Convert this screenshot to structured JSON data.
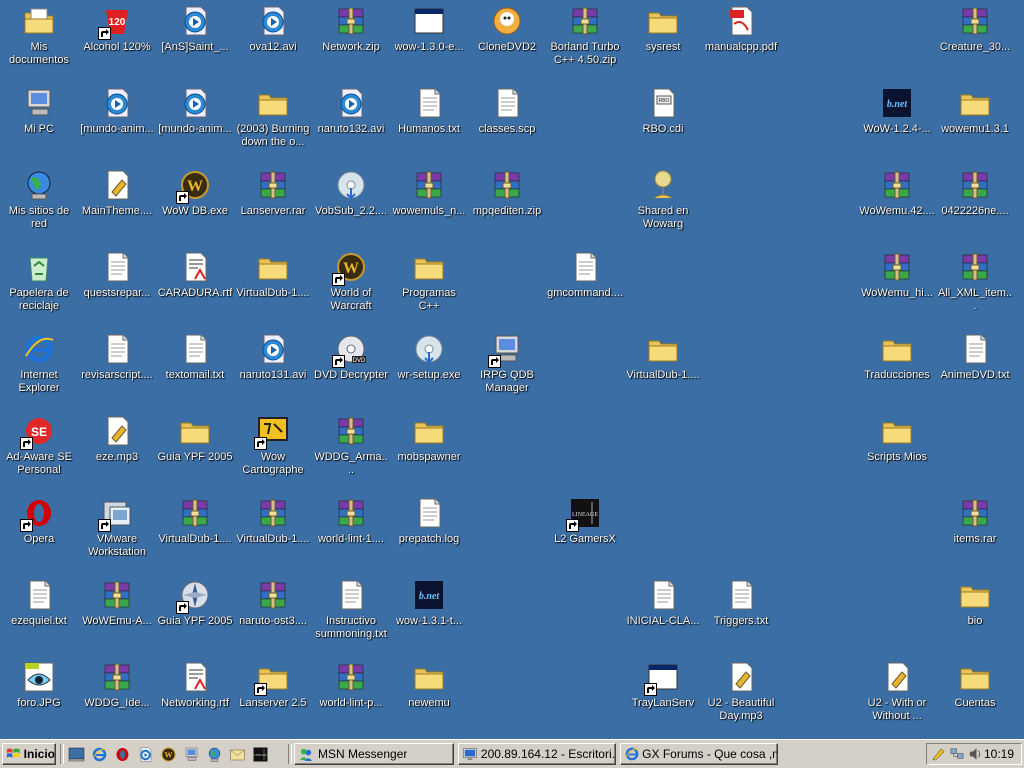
{
  "desktop": {
    "icons": [
      {
        "name": "my-documents-icon",
        "label": "Mis documentos",
        "kind": "mydocs",
        "sc": false,
        "col": 0,
        "row": 0
      },
      {
        "name": "alcohol-icon",
        "label": "Alcohol 120%",
        "kind": "alcohol",
        "sc": true,
        "col": 1,
        "row": 0
      },
      {
        "name": "avi-file-icon",
        "label": "[AnS]Saint_...",
        "kind": "media",
        "sc": false,
        "col": 2,
        "row": 0
      },
      {
        "name": "avi-file-icon",
        "label": "ova12.avi",
        "kind": "media",
        "sc": false,
        "col": 3,
        "row": 0
      },
      {
        "name": "zip-file-icon",
        "label": "Network.zip",
        "kind": "rar",
        "sc": false,
        "col": 4,
        "row": 0
      },
      {
        "name": "exe-file-icon",
        "label": "wow-1.3.0-e...",
        "kind": "window",
        "sc": false,
        "col": 5,
        "row": 0
      },
      {
        "name": "clonedvd-icon",
        "label": "CloneDVD2",
        "kind": "clonedvd",
        "sc": false,
        "col": 6,
        "row": 0
      },
      {
        "name": "zip-file-icon",
        "label": "Borland Turbo C++ 4.50.zip",
        "kind": "rar",
        "sc": false,
        "col": 7,
        "row": 0
      },
      {
        "name": "folder-icon",
        "label": "sysrest",
        "kind": "folder",
        "sc": false,
        "col": 8,
        "row": 0
      },
      {
        "name": "pdf-file-icon",
        "label": "manualcpp.pdf",
        "kind": "pdf",
        "sc": false,
        "col": 9,
        "row": 0
      },
      {
        "name": "rar-file-icon",
        "label": "Creature_30...",
        "kind": "rar",
        "sc": false,
        "col": 12,
        "row": 0
      },
      {
        "name": "my-computer-icon",
        "label": "Mi PC",
        "kind": "mypc",
        "sc": false,
        "col": 0,
        "row": 1
      },
      {
        "name": "avi-file-icon",
        "label": "[mundo-anim...",
        "kind": "media",
        "sc": false,
        "col": 1,
        "row": 1
      },
      {
        "name": "avi-file-icon",
        "label": "[mundo-anim...",
        "kind": "media",
        "sc": false,
        "col": 2,
        "row": 1
      },
      {
        "name": "folder-icon",
        "label": "(2003) Burning down the o...",
        "kind": "folder",
        "sc": false,
        "col": 3,
        "row": 1
      },
      {
        "name": "avi-file-icon",
        "label": "naruto132.avi",
        "kind": "media",
        "sc": false,
        "col": 4,
        "row": 1
      },
      {
        "name": "txt-file-icon",
        "label": "Humanos.txt",
        "kind": "txt",
        "sc": false,
        "col": 5,
        "row": 1
      },
      {
        "name": "txt-file-icon",
        "label": "classes.scp",
        "kind": "txt",
        "sc": false,
        "col": 6,
        "row": 1
      },
      {
        "name": "cdi-file-icon",
        "label": "RBO.cdi",
        "kind": "cdi",
        "sc": false,
        "col": 8,
        "row": 1
      },
      {
        "name": "bnet-icon",
        "label": "WoW-1.2.4-...",
        "kind": "bnet",
        "sc": false,
        "col": 11,
        "row": 1
      },
      {
        "name": "folder-icon",
        "label": "wowemu1.3.1",
        "kind": "folder",
        "sc": false,
        "col": 12,
        "row": 1
      },
      {
        "name": "network-places-icon",
        "label": "Mis sitios de red",
        "kind": "globe",
        "sc": false,
        "col": 0,
        "row": 2
      },
      {
        "name": "theme-file-icon",
        "label": "MainTheme....",
        "kind": "mp3",
        "sc": false,
        "col": 1,
        "row": 2
      },
      {
        "name": "wow-db-icon",
        "label": "WoW DB.exe",
        "kind": "wow",
        "sc": true,
        "col": 2,
        "row": 2
      },
      {
        "name": "rar-file-icon",
        "label": "Lanserver.rar",
        "kind": "rar",
        "sc": false,
        "col": 3,
        "row": 2
      },
      {
        "name": "vobsub-icon",
        "label": "VobSub_2.2....",
        "kind": "cd",
        "sc": false,
        "col": 4,
        "row": 2
      },
      {
        "name": "rar-file-icon",
        "label": "wowemuls_n...",
        "kind": "rar",
        "sc": false,
        "col": 5,
        "row": 2
      },
      {
        "name": "zip-file-icon",
        "label": "mpqediten.zip",
        "kind": "rar",
        "sc": false,
        "col": 6,
        "row": 2
      },
      {
        "name": "shared-folder-icon",
        "label": "Shared en Wowarg",
        "kind": "shared",
        "sc": false,
        "col": 8,
        "row": 2
      },
      {
        "name": "rar-file-icon",
        "label": "WoWemu.42....",
        "kind": "rar",
        "sc": false,
        "col": 11,
        "row": 2
      },
      {
        "name": "rar-file-icon",
        "label": "0422226ne....",
        "kind": "rar",
        "sc": false,
        "col": 12,
        "row": 2
      },
      {
        "name": "recycle-bin-icon",
        "label": "Papelera de reciclaje",
        "kind": "recycle",
        "sc": false,
        "col": 0,
        "row": 3
      },
      {
        "name": "txt-file-icon",
        "label": "questsrepar...",
        "kind": "txt",
        "sc": false,
        "col": 1,
        "row": 3
      },
      {
        "name": "rtf-file-icon",
        "label": "CARADURA.rtf",
        "kind": "rtf",
        "sc": false,
        "col": 2,
        "row": 3
      },
      {
        "name": "folder-icon",
        "label": "VirtualDub-1....",
        "kind": "folder",
        "sc": false,
        "col": 3,
        "row": 3
      },
      {
        "name": "wow-icon",
        "label": "World of Warcraft",
        "kind": "wow",
        "sc": true,
        "col": 4,
        "row": 3
      },
      {
        "name": "folder-icon",
        "label": "Programas C++",
        "kind": "folder",
        "sc": false,
        "col": 5,
        "row": 3
      },
      {
        "name": "txt-file-icon",
        "label": "gmcommand....",
        "kind": "txt",
        "sc": false,
        "col": 7,
        "row": 3
      },
      {
        "name": "rar-file-icon",
        "label": "WoWemu_hi...",
        "kind": "rar",
        "sc": false,
        "col": 11,
        "row": 3
      },
      {
        "name": "rar-file-icon",
        "label": "All_XML_item...",
        "kind": "rar",
        "sc": false,
        "col": 12,
        "row": 3
      },
      {
        "name": "internet-explorer-icon",
        "label": "Internet Explorer",
        "kind": "ie",
        "sc": false,
        "col": 0,
        "row": 4
      },
      {
        "name": "txt-file-icon",
        "label": "revisarscript....",
        "kind": "txt",
        "sc": false,
        "col": 1,
        "row": 4
      },
      {
        "name": "txt-file-icon",
        "label": "textomail.txt",
        "kind": "txt",
        "sc": false,
        "col": 2,
        "row": 4
      },
      {
        "name": "avi-file-icon",
        "label": "naruto131.avi",
        "kind": "media",
        "sc": false,
        "col": 3,
        "row": 4
      },
      {
        "name": "dvd-decrypter-icon",
        "label": "DVD Decrypter",
        "kind": "dvd",
        "sc": true,
        "col": 4,
        "row": 4
      },
      {
        "name": "setup-exe-icon",
        "label": "wr-setup.exe",
        "kind": "cd",
        "sc": false,
        "col": 5,
        "row": 4
      },
      {
        "name": "irpg-manager-icon",
        "label": "IRPG QDB Manager",
        "kind": "mypc",
        "sc": true,
        "col": 6,
        "row": 4
      },
      {
        "name": "folder-icon",
        "label": "VirtualDub-1....",
        "kind": "folder",
        "sc": false,
        "col": 8,
        "row": 4
      },
      {
        "name": "folder-icon",
        "label": "Traducciones",
        "kind": "folder",
        "sc": false,
        "col": 11,
        "row": 4
      },
      {
        "name": "txt-file-icon",
        "label": "AnimeDVD.txt",
        "kind": "txt",
        "sc": false,
        "col": 12,
        "row": 4
      },
      {
        "name": "adaware-icon",
        "label": "Ad-Aware SE Personal",
        "kind": "adaware",
        "sc": true,
        "col": 0,
        "row": 5
      },
      {
        "name": "mp3-file-icon",
        "label": "eze.mp3",
        "kind": "mp3",
        "sc": false,
        "col": 1,
        "row": 5
      },
      {
        "name": "folder-icon",
        "label": "Guia YPF 2005",
        "kind": "folder",
        "sc": false,
        "col": 2,
        "row": 5
      },
      {
        "name": "wow-cartographer-icon",
        "label": "Wow Cartographe",
        "kind": "carto",
        "sc": true,
        "col": 3,
        "row": 5
      },
      {
        "name": "rar-file-icon",
        "label": "WDDG_Arma....",
        "kind": "rar",
        "sc": false,
        "col": 4,
        "row": 5
      },
      {
        "name": "folder-icon",
        "label": "mobspawner",
        "kind": "folder",
        "sc": false,
        "col": 5,
        "row": 5
      },
      {
        "name": "folder-icon",
        "label": "Scripts Mios",
        "kind": "folder",
        "sc": false,
        "col": 11,
        "row": 5
      },
      {
        "name": "opera-icon",
        "label": "Opera",
        "kind": "opera",
        "sc": true,
        "col": 0,
        "row": 6
      },
      {
        "name": "vmware-icon",
        "label": "VMware Workstation",
        "kind": "vmware",
        "sc": true,
        "col": 1,
        "row": 6
      },
      {
        "name": "rar-file-icon",
        "label": "VirtualDub-1....",
        "kind": "rar",
        "sc": false,
        "col": 2,
        "row": 6
      },
      {
        "name": "rar-file-icon",
        "label": "VirtualDub-1....",
        "kind": "rar",
        "sc": false,
        "col": 3,
        "row": 6
      },
      {
        "name": "rar-file-icon",
        "label": "world-lint-1....",
        "kind": "rar",
        "sc": false,
        "col": 4,
        "row": 6
      },
      {
        "name": "log-file-icon",
        "label": "prepatch.log",
        "kind": "txt",
        "sc": false,
        "col": 5,
        "row": 6
      },
      {
        "name": "lineage-icon",
        "label": "L2 GamersX",
        "kind": "lineage",
        "sc": true,
        "col": 7,
        "row": 6
      },
      {
        "name": "rar-file-icon",
        "label": "items.rar",
        "kind": "rar",
        "sc": false,
        "col": 12,
        "row": 6
      },
      {
        "name": "txt-file-icon",
        "label": "ezequiel.txt",
        "kind": "txt",
        "sc": false,
        "col": 0,
        "row": 7
      },
      {
        "name": "rar-file-icon",
        "label": "WoWEmu-A...",
        "kind": "rar",
        "sc": false,
        "col": 1,
        "row": 7
      },
      {
        "name": "guia-ypf-icon",
        "label": "Guia YPF 2005",
        "kind": "compass",
        "sc": true,
        "col": 2,
        "row": 7
      },
      {
        "name": "rar-file-icon",
        "label": "naruto-ost3....",
        "kind": "rar",
        "sc": false,
        "col": 3,
        "row": 7
      },
      {
        "name": "txt-file-icon",
        "label": "Instructivo summoning.txt",
        "kind": "txt",
        "sc": false,
        "col": 4,
        "row": 7
      },
      {
        "name": "bnet-icon",
        "label": "wow-1.3.1-t...",
        "kind": "bnet",
        "sc": false,
        "col": 5,
        "row": 7
      },
      {
        "name": "txt-file-icon",
        "label": "INICIAL-CLA...",
        "kind": "txt",
        "sc": false,
        "col": 8,
        "row": 7
      },
      {
        "name": "txt-file-icon",
        "label": "Triggers.txt",
        "kind": "txt",
        "sc": false,
        "col": 9,
        "row": 7
      },
      {
        "name": "folder-icon",
        "label": "bio",
        "kind": "folder",
        "sc": false,
        "col": 12,
        "row": 7
      },
      {
        "name": "jpg-file-icon",
        "label": "foro.JPG",
        "kind": "jpg",
        "sc": false,
        "col": 0,
        "row": 8
      },
      {
        "name": "rar-file-icon",
        "label": "WDDG_Ide...",
        "kind": "rar",
        "sc": false,
        "col": 1,
        "row": 8
      },
      {
        "name": "rtf-file-icon",
        "label": "Networking.rtf",
        "kind": "rtf",
        "sc": false,
        "col": 2,
        "row": 8
      },
      {
        "name": "folder-shortcut-icon",
        "label": "Lanserver 2.5",
        "kind": "folder",
        "sc": true,
        "col": 3,
        "row": 8
      },
      {
        "name": "rar-file-icon",
        "label": "world-lint-p...",
        "kind": "rar",
        "sc": false,
        "col": 4,
        "row": 8
      },
      {
        "name": "folder-icon",
        "label": "newemu",
        "kind": "folder",
        "sc": false,
        "col": 5,
        "row": 8
      },
      {
        "name": "traylanserv-icon",
        "label": "TrayLanServ",
        "kind": "window",
        "sc": true,
        "col": 8,
        "row": 8
      },
      {
        "name": "mp3-file-icon",
        "label": "U2 - Beautiful Day.mp3",
        "kind": "mp3",
        "sc": false,
        "col": 9,
        "row": 8
      },
      {
        "name": "mp3-file-icon",
        "label": "U2 - With or Without ...",
        "kind": "mp3",
        "sc": false,
        "col": 11,
        "row": 8
      },
      {
        "name": "folder-icon",
        "label": "Cuentas",
        "kind": "folder",
        "sc": false,
        "col": 12,
        "row": 8
      }
    ]
  },
  "taskbar": {
    "start_label": "Inicio",
    "quicklaunch": [
      {
        "name": "show-desktop-icon",
        "kind": "desk"
      },
      {
        "name": "ie-quicklaunch-icon",
        "kind": "ie"
      },
      {
        "name": "opera-quicklaunch-icon",
        "kind": "opera"
      },
      {
        "name": "media-player-quicklaunch-icon",
        "kind": "media"
      },
      {
        "name": "wow-quicklaunch-icon",
        "kind": "wow"
      },
      {
        "name": "app-quicklaunch-icon",
        "kind": "mypc"
      },
      {
        "name": "network-quicklaunch-icon",
        "kind": "globe"
      },
      {
        "name": "mail-quicklaunch-icon",
        "kind": "mail"
      },
      {
        "name": "lineage-quicklaunch-icon",
        "kind": "lineage"
      }
    ],
    "tasks": [
      {
        "label": "MSN Messenger",
        "kind": "msn"
      },
      {
        "label": "200.89.164.12 - Escritori...",
        "kind": "rdp"
      },
      {
        "label": "GX Forums - Que cosa ,n...",
        "kind": "ie"
      }
    ],
    "tray": {
      "clock": "10:19",
      "icons": [
        {
          "name": "tray-pen-icon",
          "kind": "pen"
        },
        {
          "name": "tray-network-icon",
          "kind": "net"
        },
        {
          "name": "tray-sound-icon",
          "kind": "sound"
        }
      ]
    }
  }
}
